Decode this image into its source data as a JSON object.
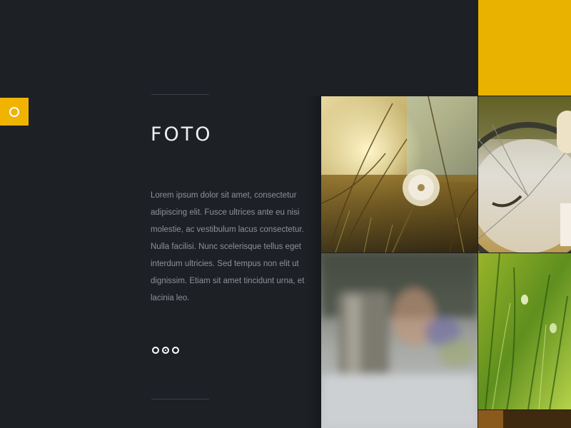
{
  "sidebar": {
    "menu_toggle_icon": "circle-icon"
  },
  "section": {
    "title": "FOTO",
    "body": "Lorem ipsum dolor sit amet, consectetur adipiscing elit. Fusce ultrices ante eu nisi molestie, ac vestibulum lacus consectetur. Nulla facilisi. Nunc scelerisque tellus eget interdum ultricies. Sed tempus non elit ut dignissim. Etiam sit amet tincidunt urna, et lacinia leo."
  },
  "pager": {
    "count": 3,
    "active_index": 1
  },
  "gallery": {
    "tiles": [
      {
        "subject": "dandelion-sunset-photo"
      },
      {
        "subject": "bicycle-wheel-photo"
      },
      {
        "subject": "blurred-cup-photo"
      },
      {
        "subject": "green-grass-photo"
      },
      {
        "subject": "partial-photo"
      }
    ]
  },
  "colors": {
    "background": "#1d2025",
    "accent": "#f0b400",
    "text_muted": "#8d929a",
    "title": "#eef0f2"
  }
}
